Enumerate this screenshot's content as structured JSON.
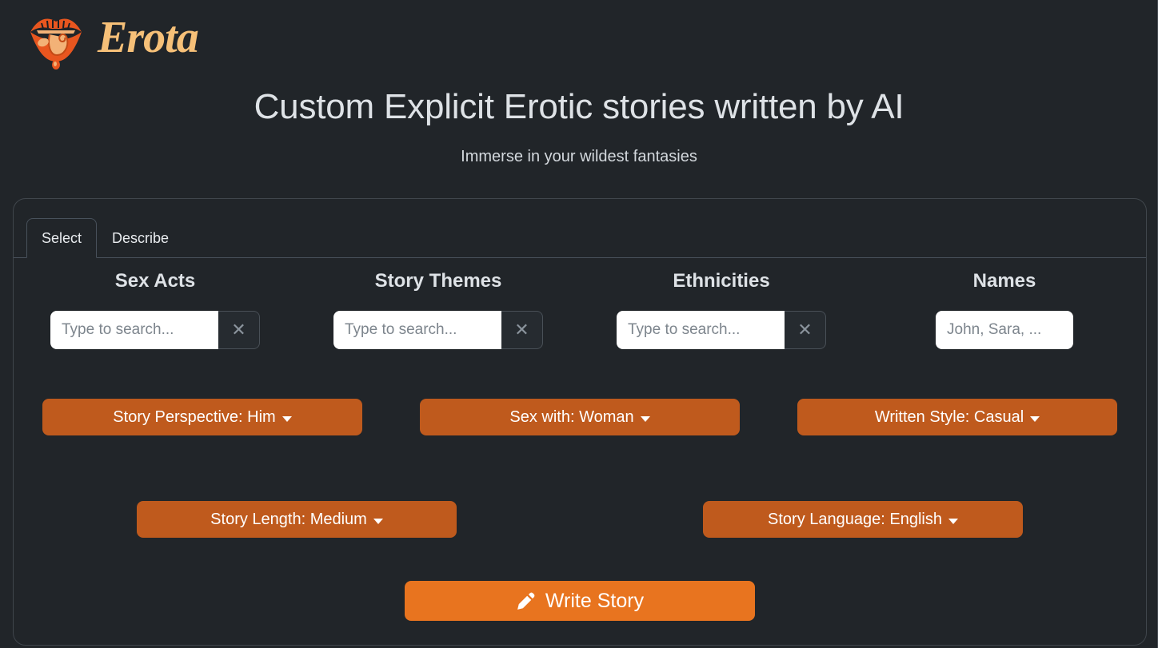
{
  "brand": {
    "logo_icon": "lips-tongue-icon",
    "wordmark": "Erota",
    "wordmark_color": "#f6c078",
    "lips_color": "#e8561f",
    "tongue_color": "#f3b277"
  },
  "hero": {
    "title": "Custom Explicit Erotic stories written by AI",
    "subtitle": "Immerse in your wildest fantasies"
  },
  "tabs": [
    {
      "label": "Select",
      "active": true
    },
    {
      "label": "Describe",
      "active": false
    }
  ],
  "columns": [
    {
      "title": "Sex Acts",
      "input_value": "",
      "placeholder": "Type to search...",
      "has_clear": true,
      "clear_icon": "close-icon"
    },
    {
      "title": "Story Themes",
      "input_value": "",
      "placeholder": "Type to search...",
      "has_clear": true,
      "clear_icon": "close-icon"
    },
    {
      "title": "Ethnicities",
      "input_value": "",
      "placeholder": "Type to search...",
      "has_clear": true,
      "clear_icon": "close-icon"
    },
    {
      "title": "Names",
      "input_value": "",
      "placeholder": "John, Sara, ...",
      "has_clear": false,
      "clear_icon": ""
    }
  ],
  "dropdowns_row1": [
    {
      "label": "Story Perspective: Him",
      "caret_icon": "chevron-down-icon"
    },
    {
      "label": "Sex with: Woman",
      "caret_icon": "chevron-down-icon"
    },
    {
      "label": "Written Style: Casual",
      "caret_icon": "chevron-down-icon"
    }
  ],
  "dropdowns_row2": [
    {
      "label": "Story Length: Medium",
      "caret_icon": "chevron-down-icon"
    },
    {
      "label": "Story Language: English",
      "caret_icon": "chevron-down-icon"
    }
  ],
  "submit": {
    "label": "Write Story",
    "icon": "pen-icon",
    "color": "#e8741f"
  },
  "theme": {
    "background": "#212529",
    "accent_orange": "#e8741f",
    "dropdown_orange": "#bf5a1d",
    "text": "#e9ecef",
    "border": "#40464c"
  }
}
